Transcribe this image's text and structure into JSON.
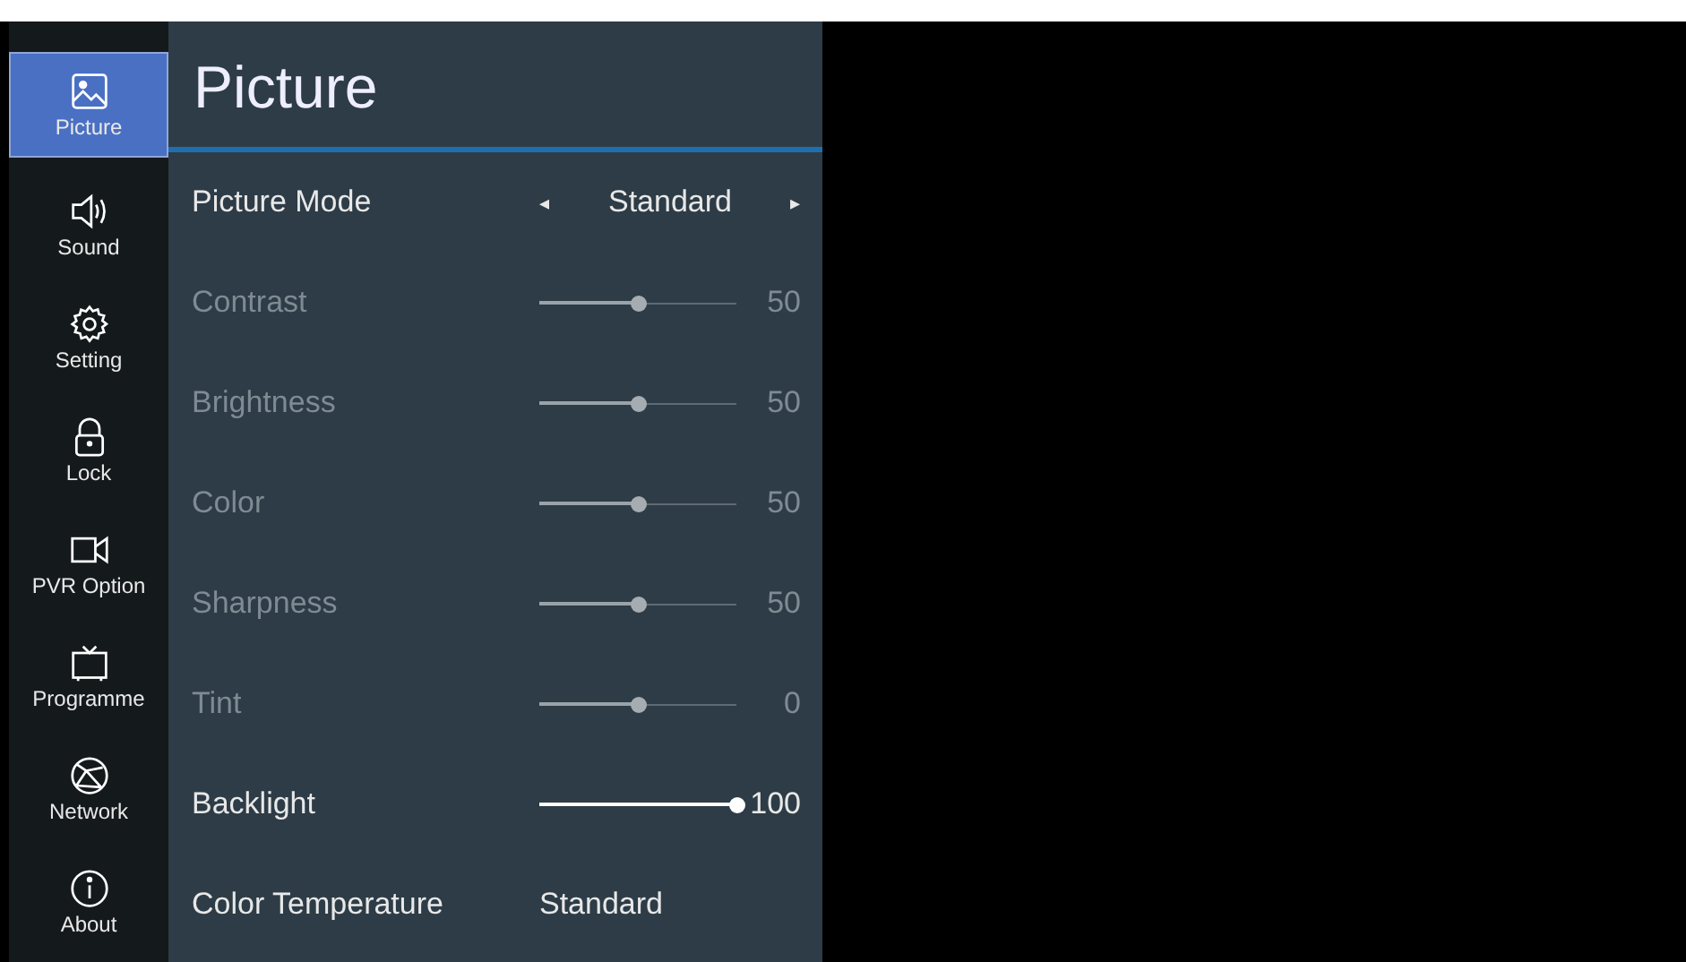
{
  "sidebar": {
    "items": [
      {
        "label": "Picture",
        "selected": true
      },
      {
        "label": "Sound",
        "selected": false
      },
      {
        "label": "Setting",
        "selected": false
      },
      {
        "label": "Lock",
        "selected": false
      },
      {
        "label": "PVR Option",
        "selected": false
      },
      {
        "label": "Programme",
        "selected": false
      },
      {
        "label": "Network",
        "selected": false
      },
      {
        "label": "About",
        "selected": false
      }
    ]
  },
  "panel": {
    "title": "Picture",
    "rows": [
      {
        "kind": "select",
        "label": "Picture Mode",
        "value": "Standard",
        "left": "◂",
        "right": "▸",
        "disabled": false
      },
      {
        "kind": "slider",
        "label": "Contrast",
        "level": 0.5,
        "reading": "50",
        "disabled": true
      },
      {
        "kind": "slider",
        "label": "Brightness",
        "level": 0.5,
        "reading": "50",
        "disabled": true
      },
      {
        "kind": "slider",
        "label": "Color",
        "level": 0.5,
        "reading": "50",
        "disabled": true
      },
      {
        "kind": "slider",
        "label": "Sharpness",
        "level": 0.5,
        "reading": "50",
        "disabled": true
      },
      {
        "kind": "slider",
        "label": "Tint",
        "level": 0.5,
        "reading": "0",
        "disabled": true
      },
      {
        "kind": "slider",
        "label": "Backlight",
        "level": 1,
        "reading": "100",
        "disabled": false
      },
      {
        "kind": "select",
        "label": "Color Temperature",
        "value": "Standard",
        "disabled": false
      }
    ]
  }
}
